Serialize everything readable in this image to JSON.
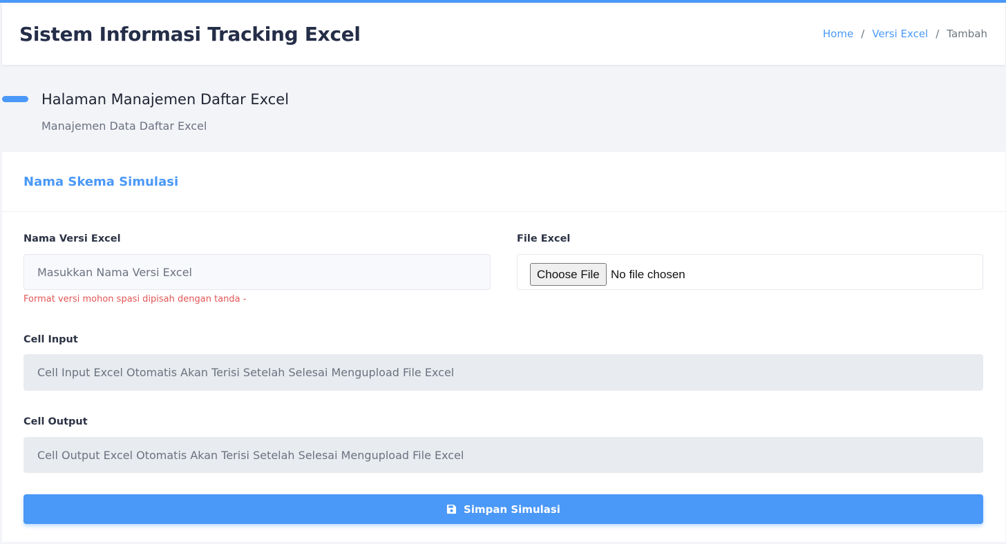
{
  "header": {
    "app_title": "Sistem Informasi Tracking Excel",
    "breadcrumb": {
      "home": "Home",
      "section": "Versi Excel",
      "current": "Tambah",
      "separator": "/"
    }
  },
  "page": {
    "title": "Halaman Manajemen Daftar Excel",
    "subtitle": "Manajemen Data Daftar Excel"
  },
  "form": {
    "card_title": "Nama Skema Simulasi",
    "version_name": {
      "label": "Nama Versi Excel",
      "placeholder": "Masukkan Nama Versi Excel",
      "value": "",
      "help": "Format versi mohon spasi dipisah dengan tanda -"
    },
    "file": {
      "label": "File Excel",
      "button_label": "Choose File",
      "status": "No file chosen"
    },
    "cell_input": {
      "label": "Cell Input",
      "placeholder": "Cell Input Excel Otomatis Akan Terisi Setelah Selesai Mengupload File Excel"
    },
    "cell_output": {
      "label": "Cell Output",
      "placeholder": "Cell Output Excel Otomatis Akan Terisi Setelah Selesai Mengupload File Excel"
    },
    "submit": {
      "label": "Simpan Simulasi",
      "icon": "save-icon"
    }
  },
  "colors": {
    "accent": "#4a98f7",
    "error": "#e25555",
    "background": "#f3f4f8"
  }
}
